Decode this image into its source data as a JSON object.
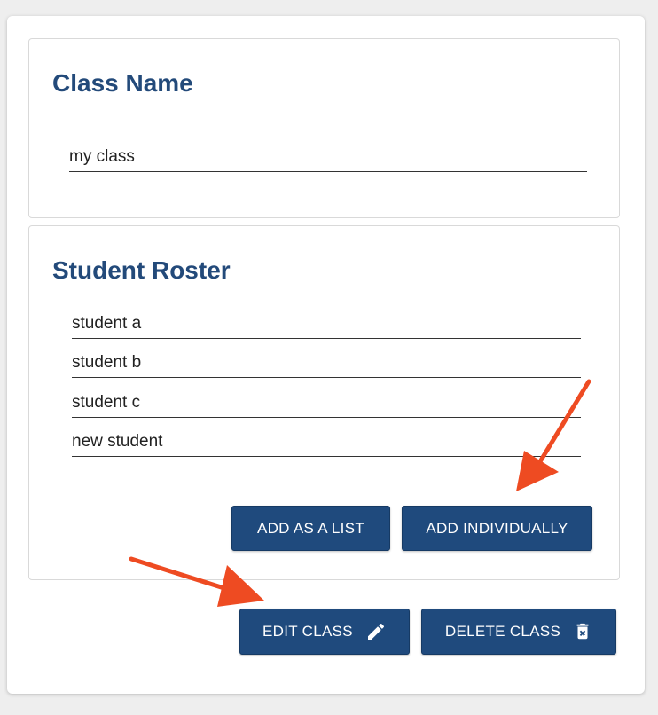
{
  "class_section": {
    "title": "Class Name",
    "class_name_value": "my class"
  },
  "roster_section": {
    "title": "Student Roster",
    "students": [
      "student a",
      "student b",
      "student c",
      "new student"
    ],
    "add_list_label": "ADD AS A LIST",
    "add_individually_label": "ADD INDIVIDUALLY"
  },
  "actions": {
    "edit_label": "EDIT CLASS",
    "delete_label": "DELETE CLASS",
    "edit_icon": "pencil-icon",
    "delete_icon": "trash-icon"
  },
  "colors": {
    "primary": "#1f4a7d",
    "heading": "#234a7a",
    "annotation_arrow": "#ee4b22"
  }
}
